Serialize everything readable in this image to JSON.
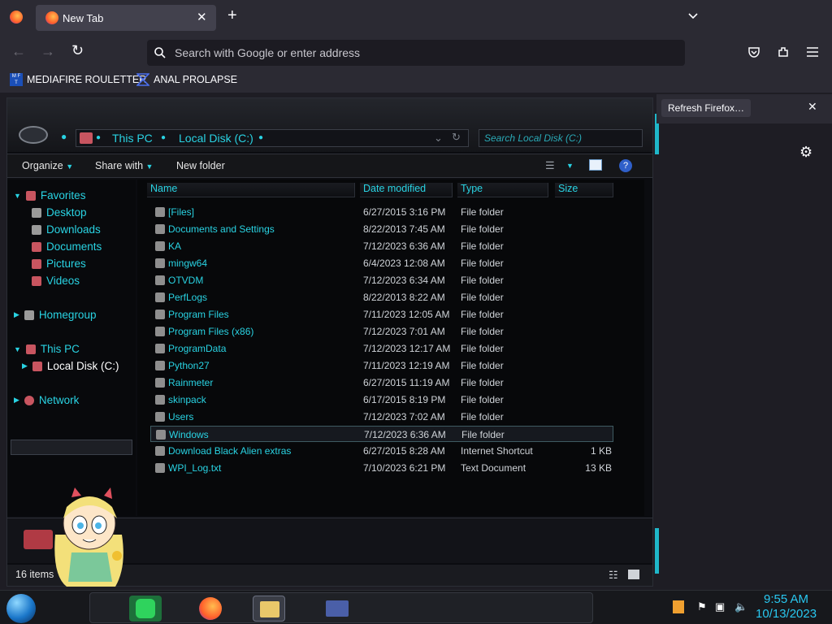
{
  "browser": {
    "tab_title": "New Tab",
    "url_placeholder": "Search with Google or enter address",
    "bookmarks": [
      {
        "label": "MEDIAFIRE ROULETTER",
        "icon": "mediafire-icon"
      },
      {
        "label": "ANAL PROLAPSE",
        "icon": "bookmark-icon"
      }
    ],
    "notification_button": "Refresh Firefox…"
  },
  "explorer": {
    "breadcrumbs": [
      "This PC",
      "Local Disk (C:)"
    ],
    "search_placeholder": "Search Local Disk (C:)",
    "commands": {
      "organize": "Organize",
      "share": "Share with",
      "new_folder": "New folder"
    },
    "nav": {
      "favorites": "Favorites",
      "fav_items": [
        "Desktop",
        "Downloads",
        "Documents",
        "Pictures",
        "Videos"
      ],
      "homegroup": "Homegroup",
      "this_pc": "This PC",
      "local_disk": "Local Disk (C:)",
      "network": "Network"
    },
    "columns": {
      "name": "Name",
      "date": "Date modified",
      "type": "Type",
      "size": "Size"
    },
    "files": [
      {
        "name": "[Files]",
        "date": "6/27/2015 3:16 PM",
        "type": "File folder",
        "size": ""
      },
      {
        "name": "Documents and Settings",
        "date": "8/22/2013 7:45 AM",
        "type": "File folder",
        "size": ""
      },
      {
        "name": "KA",
        "date": "7/12/2023 6:36 AM",
        "type": "File folder",
        "size": ""
      },
      {
        "name": "mingw64",
        "date": "6/4/2023 12:08 AM",
        "type": "File folder",
        "size": ""
      },
      {
        "name": "OTVDM",
        "date": "7/12/2023 6:34 AM",
        "type": "File folder",
        "size": ""
      },
      {
        "name": "PerfLogs",
        "date": "8/22/2013 8:22 AM",
        "type": "File folder",
        "size": ""
      },
      {
        "name": "Program Files",
        "date": "7/11/2023 12:05 AM",
        "type": "File folder",
        "size": ""
      },
      {
        "name": "Program Files (x86)",
        "date": "7/12/2023 7:01 AM",
        "type": "File folder",
        "size": ""
      },
      {
        "name": "ProgramData",
        "date": "7/12/2023 12:17 AM",
        "type": "File folder",
        "size": ""
      },
      {
        "name": "Python27",
        "date": "7/11/2023 12:19 AM",
        "type": "File folder",
        "size": ""
      },
      {
        "name": "Rainmeter",
        "date": "6/27/2015 11:19 AM",
        "type": "File folder",
        "size": ""
      },
      {
        "name": "skinpack",
        "date": "6/17/2015 8:19 PM",
        "type": "File folder",
        "size": ""
      },
      {
        "name": "Users",
        "date": "7/12/2023 7:02 AM",
        "type": "File folder",
        "size": ""
      },
      {
        "name": "Windows",
        "date": "7/12/2023 6:36 AM",
        "type": "File folder",
        "size": ""
      },
      {
        "name": "Download Black Alien extras",
        "date": "6/27/2015 8:28 AM",
        "type": "Internet Shortcut",
        "size": "1 KB"
      },
      {
        "name": "WPI_Log.txt",
        "date": "7/10/2023 6:21 PM",
        "type": "Text Document",
        "size": "13 KB"
      }
    ],
    "selected_row": 13,
    "status": "16 items"
  },
  "taskbar": {
    "time": "9:55 AM",
    "date": "10/13/2023"
  }
}
